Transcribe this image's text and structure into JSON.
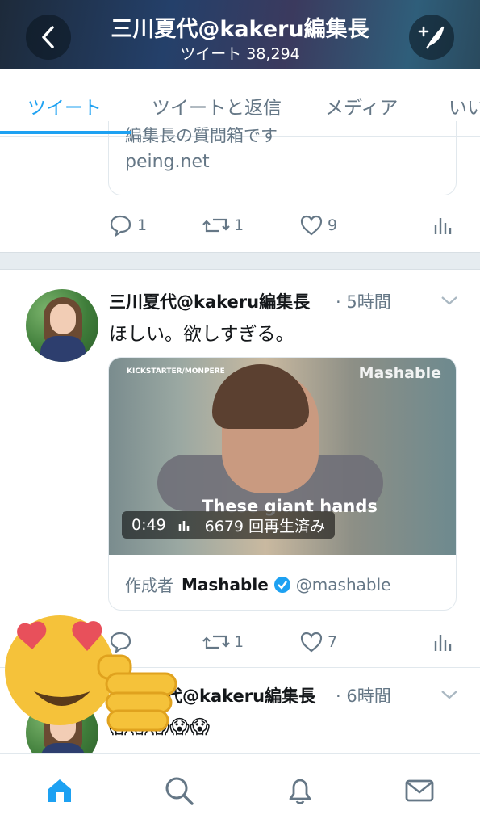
{
  "header": {
    "title": "三川夏代@kakeru編集長",
    "subtitle": "ツイート 38,294"
  },
  "tabs": [
    {
      "label": "ツイート",
      "active": true
    },
    {
      "label": "ツイートと返信",
      "active": false
    },
    {
      "label": "メディア",
      "active": false
    },
    {
      "label": "いい",
      "active": false
    }
  ],
  "prev_tweet": {
    "card_text_cut": "編集長の質問箱です",
    "card_domain": "peing.net",
    "replies": "1",
    "retweets": "1",
    "likes": "9"
  },
  "tweet1": {
    "name": "三川夏代@kakeru編集長",
    "time": "· 5時間",
    "text": "ほしい。欲しすぎる。",
    "video_source": "KICKSTARTER/MONPERE",
    "video_brand": "Mashable",
    "video_caption": "These giant hands",
    "duration": "0:49",
    "views": "6679 回再生済み",
    "card_author_prefix": "作成者",
    "card_author": "Mashable",
    "card_handle": "@mashable",
    "replies": "",
    "retweets": "1",
    "likes": "7"
  },
  "tweet2": {
    "name": "代@kakeru編集長",
    "time": "· 6時間",
    "text": "😱😱😱😱😱"
  },
  "colors": {
    "accent": "#1da1f2",
    "muted": "#657786",
    "separator": "#e6ecf0"
  }
}
